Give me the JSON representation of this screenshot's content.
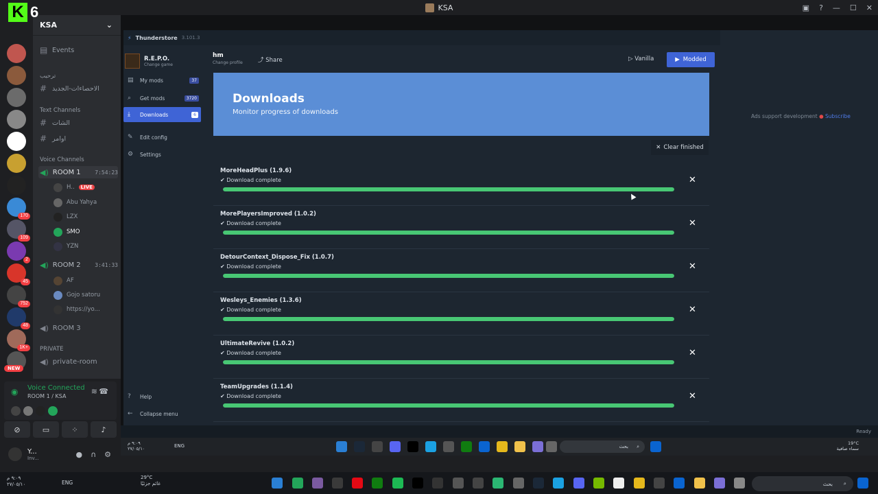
{
  "window": {
    "title": "KSA"
  },
  "brand": {
    "letter": "K",
    "number": "6"
  },
  "server_rail": {
    "badges": [
      "170",
      "109",
      "2",
      "45",
      "752",
      "48",
      "1K+"
    ],
    "new_label": "NEW"
  },
  "server": {
    "name": "KSA",
    "events": "Events",
    "cat_welcome": "ترحيب",
    "ch_stats": "الاحصاءات-الجديد",
    "cat_text": "Text Channels",
    "ch_chat": "الشات",
    "ch_orders": "اوامر",
    "cat_voice": "Voice Channels",
    "room1": {
      "name": "ROOM 1",
      "time": "7:54:23"
    },
    "room1_users": [
      "H..",
      "Abu Yahya",
      "LZX",
      "SMO",
      "YZN"
    ],
    "live_label": "LIVE",
    "room2": {
      "name": "ROOM 2",
      "time": "3:41:33"
    },
    "room2_users": [
      "AF",
      "Gojo satoru",
      "https://yo..."
    ],
    "room3": "ROOM 3",
    "cat_private": "PRIVATE",
    "private_room": "private-room"
  },
  "voice": {
    "status": "Voice Connected",
    "location": "ROOM 1 / KSA"
  },
  "user": {
    "name": "Y...",
    "sub": "Inv..."
  },
  "thunderstore": {
    "app_name": "Thunderstore",
    "version": "3.101.3",
    "game": {
      "name": "R.E.P.O.",
      "sub": "Change game"
    },
    "nav": [
      {
        "label": "My mods",
        "count": "37"
      },
      {
        "label": "Get mods",
        "count": "3720"
      },
      {
        "label": "Downloads",
        "count": "6"
      },
      {
        "label": "Edit config"
      },
      {
        "label": "Settings"
      },
      {
        "label": "Help"
      },
      {
        "label": "Collapse menu"
      }
    ],
    "profile": {
      "name": "hm",
      "sub": "Change profile"
    },
    "share": "Share",
    "vanilla": "Vanilla",
    "modded": "Modded",
    "banner": {
      "title": "Downloads",
      "subtitle": "Monitor progress of downloads"
    },
    "clear_finished": "Clear finished",
    "downloads": [
      {
        "name": "MoreHeadPlus (1.9.6)",
        "status": "Download complete",
        "progress": 1.0
      },
      {
        "name": "MorePlayersImproved (1.0.2)",
        "status": "Download complete",
        "progress": 1.0
      },
      {
        "name": "DetourContext_Dispose_Fix (1.0.7)",
        "status": "Download complete",
        "progress": 1.0
      },
      {
        "name": "Wesleys_Enemies (1.3.6)",
        "status": "Download complete",
        "progress": 1.0
      },
      {
        "name": "UltimateRevive (1.0.2)",
        "status": "Download complete",
        "progress": 1.0
      },
      {
        "name": "TeamUpgrades (1.1.4)",
        "status": "Download complete",
        "progress": 1.0
      }
    ],
    "ads_text": "Ads support development",
    "subscribe": "Subscribe",
    "status": "Ready"
  },
  "inner_taskbar": {
    "time": "٩:٠٩ م",
    "date": "٢٧/٠٥/١٠",
    "lang": "ENG",
    "search": "بحث",
    "weather": "19°C",
    "weather_desc": "سماء صافية"
  },
  "outer_taskbar": {
    "time": "٩:٠٩ م",
    "date": "٢٧/٠٥/١٠",
    "lang": "ENG",
    "weather": "29°C",
    "weather_desc": "غائم جزئيًا",
    "search": "بحث"
  },
  "colors": {
    "accent": "#3f64d6",
    "banner": "#5b8ed6",
    "progress": "#48c774",
    "kick": "#53fc18",
    "voice_green": "#23a55a"
  }
}
